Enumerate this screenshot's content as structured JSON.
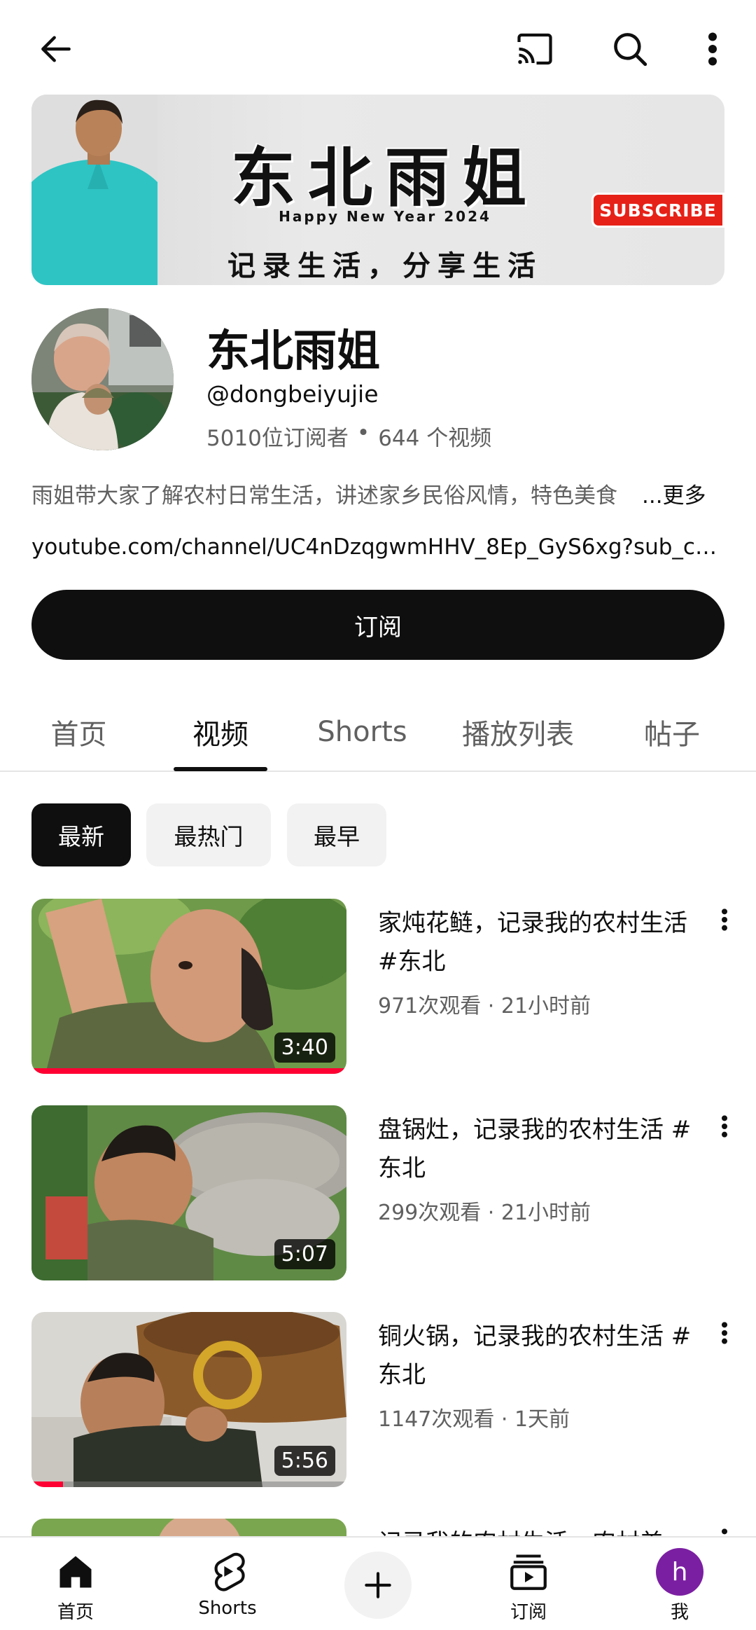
{
  "banner": {
    "title": "东北雨姐",
    "subtitle": "Happy New Year 2024",
    "tagline": "记录生活，分享生活",
    "subscribe_badge": "SUBSCRIBE"
  },
  "channel": {
    "name": "东北雨姐",
    "handle": "@dongbeiyujie",
    "subscribers": "5010位订阅者",
    "separator": "•",
    "videos_count": "644 个视频",
    "description": "雨姐带大家了解农村日常生活，讲述家乡民俗风情，特色美食",
    "more_label": "...更多",
    "link": "youtube.com/channel/UC4nDzqgwmHHV_8Ep_GyS6xg?sub_co…",
    "subscribe_label": "订阅"
  },
  "tabs": [
    {
      "label": "首页"
    },
    {
      "label": "视频"
    },
    {
      "label": "Shorts"
    },
    {
      "label": "播放列表"
    },
    {
      "label": "帖子"
    }
  ],
  "active_tab": "视频",
  "chips": [
    {
      "label": "最新"
    },
    {
      "label": "最热门"
    },
    {
      "label": "最早"
    }
  ],
  "videos": [
    {
      "title": "家炖花鲢，记录我的农村生活 #东北",
      "meta": "971次观看 · 21小时前",
      "duration": "3:40",
      "progress": 1.0
    },
    {
      "title": "盘锅灶，记录我的农村生活 #东北",
      "meta": "299次观看 · 21小时前",
      "duration": "5:07",
      "progress": 0
    },
    {
      "title": "铜火锅，记录我的农村生活 #东北",
      "meta": "1147次观看 · 1天前",
      "duration": "5:56",
      "progress": 0.1
    },
    {
      "title": "记录我的农村生活，农村美",
      "meta": "",
      "duration": "",
      "progress": 0
    }
  ],
  "bottom_nav": {
    "home": "首页",
    "shorts": "Shorts",
    "subscriptions": "订阅",
    "me": "我",
    "me_initial": "h"
  },
  "colors": {
    "accent_red": "#ff0033",
    "me_avatar": "#7b1fa2"
  }
}
